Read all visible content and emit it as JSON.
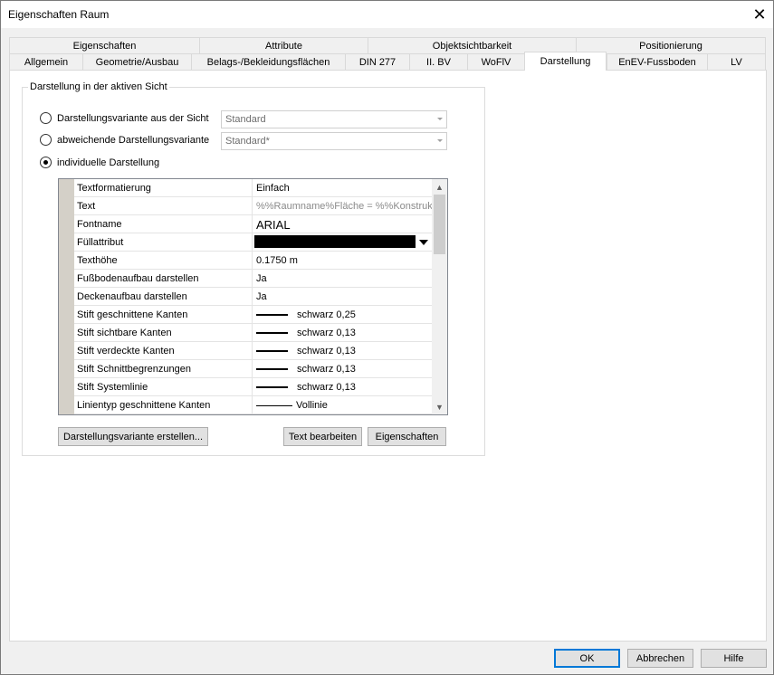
{
  "window": {
    "title": "Eigenschaften Raum"
  },
  "tabs_row1": [
    "Eigenschaften",
    "Attribute",
    "Objektsichtbarkeit",
    "Positionierung"
  ],
  "tabs_row2": [
    "Allgemein",
    "Geometrie/Ausbau",
    "Belags-/Bekleidungsflächen",
    "DIN 277",
    "II. BV",
    "WoFlV",
    "Darstellung",
    "EnEV-Fussboden",
    "LV"
  ],
  "active_tab": "Darstellung",
  "group": {
    "legend": "Darstellung in der aktiven Sicht",
    "radio1": {
      "label": "Darstellungsvariante aus der Sicht",
      "combo": "Standard"
    },
    "radio2": {
      "label": "abweichende Darstellungsvariante",
      "combo": "Standard*"
    },
    "radio3": {
      "label": "individuelle Darstellung"
    }
  },
  "grid": {
    "rows": [
      {
        "name": "Textformatierung",
        "value": "Einfach"
      },
      {
        "name": "Text",
        "value": "%%Raumname%Fläche = %%Konstruk"
      },
      {
        "name": "Fontname",
        "value": "ARIAL"
      },
      {
        "name": "Füllattribut",
        "value": ""
      },
      {
        "name": "Texthöhe",
        "value": "0.1750 m"
      },
      {
        "name": "Fußbodenaufbau darstellen",
        "value": "Ja"
      },
      {
        "name": "Deckenaufbau darstellen",
        "value": "Ja"
      },
      {
        "name": "Stift geschnittene Kanten",
        "value": "schwarz 0,25"
      },
      {
        "name": "Stift sichtbare Kanten",
        "value": "schwarz 0,13"
      },
      {
        "name": "Stift verdeckte Kanten",
        "value": "schwarz 0,13"
      },
      {
        "name": "Stift Schnittbegrenzungen",
        "value": "schwarz 0,13"
      },
      {
        "name": "Stift Systemlinie",
        "value": "schwarz 0,13"
      },
      {
        "name": "Linientyp geschnittene Kanten",
        "value": "Vollinie"
      }
    ]
  },
  "buttons": {
    "create_variant": "Darstellungsvariante erstellen...",
    "edit_text": "Text bearbeiten",
    "properties": "Eigenschaften",
    "ok": "OK",
    "cancel": "Abbrechen",
    "help": "Hilfe"
  },
  "colors": {
    "accent": "#0078d7",
    "fill_attribute": "#000000"
  }
}
